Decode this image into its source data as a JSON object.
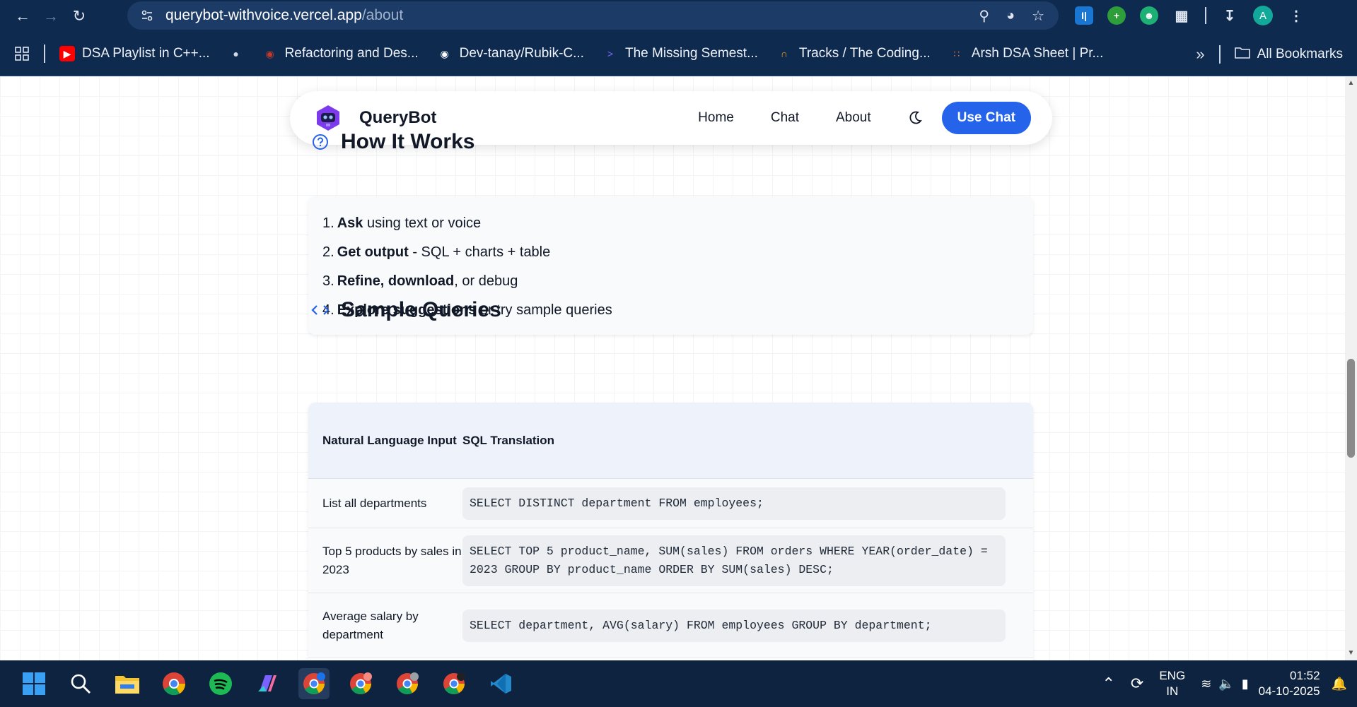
{
  "browser": {
    "url_host": "querybot-withvoice.vercel.app",
    "url_path": "/about",
    "profile_initial": "A",
    "bookmarks": [
      {
        "label": "DSA Playlist in C++...",
        "icon": "youtube-icon",
        "color": "#ff0000"
      },
      {
        "label": "",
        "icon": "globe-icon",
        "color": "#cfd8e6"
      },
      {
        "label": "Refactoring and Des...",
        "icon": "raccoon-icon",
        "color": "#c0392b"
      },
      {
        "label": "Dev-tanay/Rubik-C...",
        "icon": "github-icon",
        "color": "#ffffff"
      },
      {
        "label": "The Missing Semest...",
        "icon": "terminal-icon",
        "color": "#7c6cff"
      },
      {
        "label": "Tracks / The Coding...",
        "icon": "rainbow-icon",
        "color": "#f39c12"
      },
      {
        "label": "Arsh DSA Sheet | Pr...",
        "icon": "grid-dots-icon",
        "color": "#f26b1d"
      }
    ],
    "all_bookmarks": "All Bookmarks"
  },
  "navbar": {
    "brand": "QueryBot",
    "links": [
      "Home",
      "Chat",
      "About"
    ],
    "cta": "Use Chat"
  },
  "how": {
    "title": "How It Works",
    "steps": [
      {
        "num": "1.",
        "bold": "Ask",
        "rest": " using text or voice"
      },
      {
        "num": "2.",
        "bold": "Get output",
        "rest": " - SQL + charts + table"
      },
      {
        "num": "3.",
        "bold": "Refine, download",
        "rest": ", or debug"
      },
      {
        "num": "4.",
        "bold": "Explore suggestions",
        "rest": " or try sample queries"
      }
    ]
  },
  "samples": {
    "title": "Sample Queries",
    "col1": "Natural Language Input",
    "col2": "SQL Translation",
    "rows": [
      {
        "input": "List all departments",
        "sql": "SELECT DISTINCT department FROM employees;"
      },
      {
        "input": "Top 5 products by sales in 2023",
        "sql": "SELECT TOP 5 product_name, SUM(sales) FROM orders WHERE YEAR(order_date) = 2023 GROUP BY product_name ORDER BY SUM(sales) DESC;"
      },
      {
        "input": "Average salary by department",
        "sql": "SELECT department, AVG(salary) FROM employees GROUP BY department;"
      }
    ]
  },
  "taskbar": {
    "lang_top": "ENG",
    "lang_bottom": "IN",
    "time": "01:52",
    "date": "04-10-2025"
  }
}
